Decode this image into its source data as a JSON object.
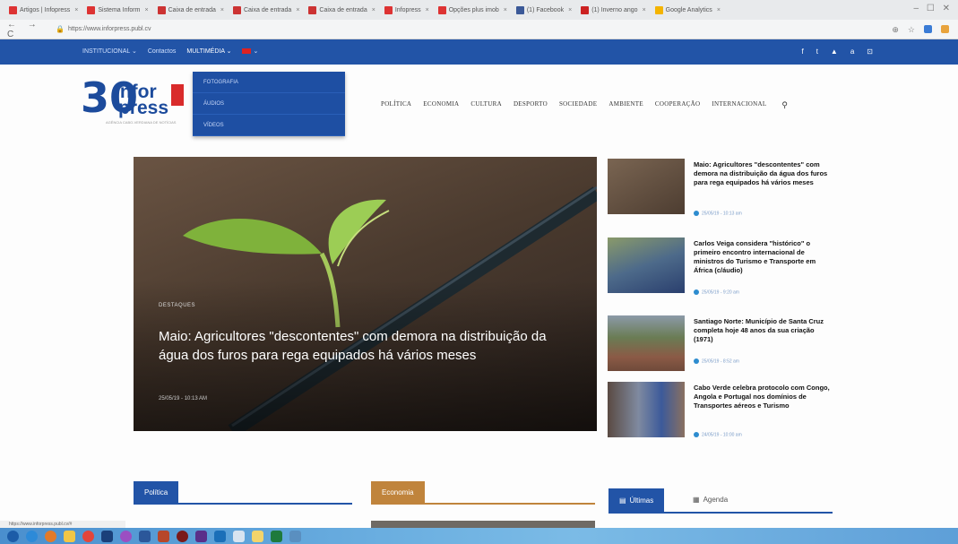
{
  "browser": {
    "tabs": [
      {
        "title": "Artigos | Infopress",
        "color": "#d33"
      },
      {
        "title": "Sistema Inform",
        "color": "#d33"
      },
      {
        "title": "Caixa de entrada",
        "color": "#c33"
      },
      {
        "title": "Caixa de entrada",
        "color": "#c33"
      },
      {
        "title": "Caixa de entrada",
        "color": "#c33"
      },
      {
        "title": "Infopress",
        "color": "#d33"
      },
      {
        "title": "Opções plus imob",
        "color": "#d33"
      },
      {
        "title": "(1) Facebook",
        "color": "#3b5998"
      },
      {
        "title": "(1) Inverno ango",
        "color": "#c22"
      },
      {
        "title": "Google Analytics",
        "color": "#f4b400"
      }
    ],
    "address": "https://www.inforpress.publ.cv",
    "status_url": "https://www.inforpress.publ.cv/#"
  },
  "topbar": {
    "items": [
      "INSTITUCIONAL",
      "Contactos",
      "MULTIMÉDIA"
    ],
    "social": [
      "f",
      "t",
      "▲",
      "a",
      "⊡"
    ]
  },
  "dropdown": {
    "items": [
      "FOTOGRAFIA",
      "ÁUDIOS",
      "VÍDEOS"
    ]
  },
  "logo": {
    "number": "30",
    "word1": "infor",
    "word2": "press",
    "tagline": "AGÊNCIA CABO-VERDIANA DE NOTÍCIAS"
  },
  "mainnav": [
    "POLÍTICA",
    "ECONOMIA",
    "CULTURA",
    "DESPORTO",
    "SOCIEDADE",
    "AMBIENTE",
    "COOPERAÇÃO",
    "INTERNACIONAL"
  ],
  "hero": {
    "category": "DESTAQUES",
    "title": "Maio: Agricultores \"descontentes\" com demora na distribuição da água dos furos para rega equipados há vários meses",
    "date": "25/05/19 - 10:13 AM"
  },
  "side_news": [
    {
      "title": "Maio: Agricultores \"descontentes\" com demora na distribuição da água dos furos para rega equipados há vários meses",
      "date": "25/05/19 - 10:13 am"
    },
    {
      "title": "Carlos Veiga considera \"histórico\" o primeiro encontro internacional de ministros do Turismo e Transporte em África (c/áudio)",
      "date": "25/05/19 - 9:20 am"
    },
    {
      "title": "Santiago Norte: Município de Santa Cruz completa hoje 48 anos da sua criação (1971)",
      "date": "25/05/19 - 8:52 am"
    },
    {
      "title": "Cabo Verde celebra protocolo com Congo, Angola e Portugal nos domínios de Transportes aéreos e Turismo",
      "date": "24/05/19 - 10:00 am"
    }
  ],
  "sections": [
    {
      "label": "Política",
      "color": "#2254a7"
    },
    {
      "label": "Economia",
      "color": "#c0843c"
    },
    {
      "label": "Últimas",
      "color": "#2254a7"
    },
    {
      "label": "Agenda",
      "color": "#ffffff"
    }
  ]
}
